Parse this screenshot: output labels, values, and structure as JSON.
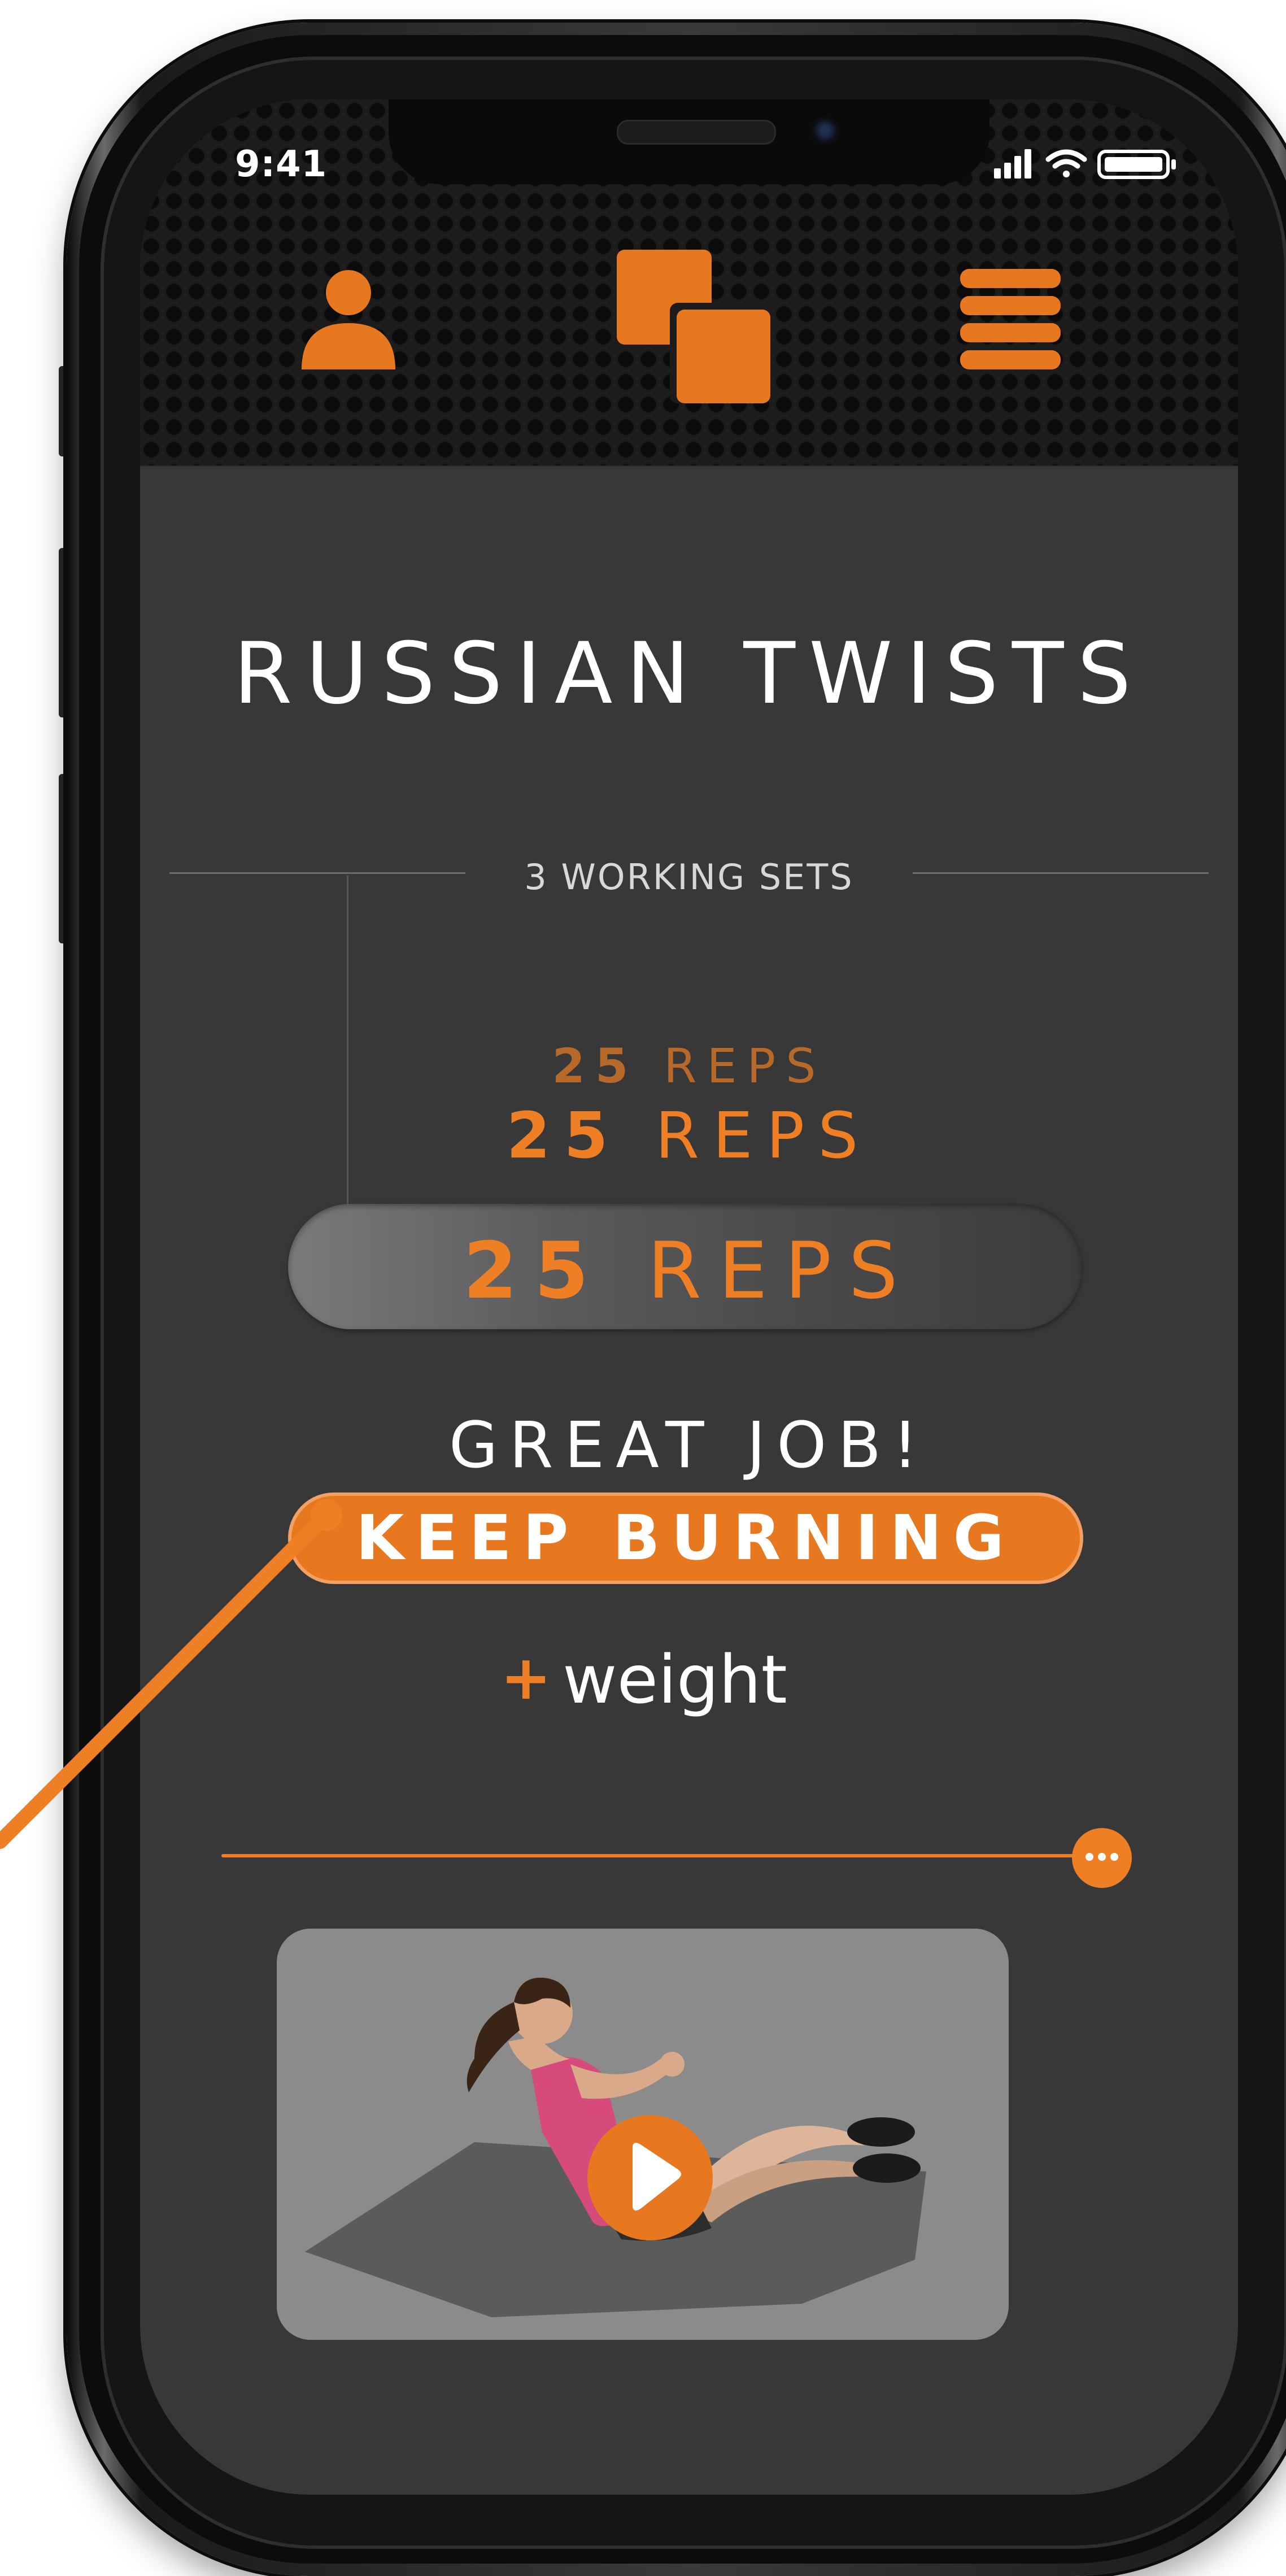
{
  "status_bar": {
    "time": "9:41"
  },
  "header": {
    "profile_icon": "user-icon",
    "logo_icon": "overlapping-squares-logo",
    "menu_icon": "hamburger-menu-icon"
  },
  "exercise": {
    "title": "RUSSIAN TWISTS",
    "sets_label": "3 WORKING SETS",
    "sets": [
      {
        "number": "25",
        "unit": "REPS"
      },
      {
        "number": "25",
        "unit": "REPS"
      },
      {
        "number": "25",
        "unit": "REPS"
      }
    ]
  },
  "feedback": {
    "message": "GREAT JOB!",
    "cta": "KEEP BURNING"
  },
  "weight": {
    "plus": "+",
    "label": "weight"
  },
  "progress": {
    "value": 1.0,
    "knob_icon": "more-dots-icon"
  },
  "video": {
    "play_icon": "play-icon"
  },
  "colors": {
    "accent": "#ee7f24",
    "background": "#383838",
    "header": "#1c1c1c",
    "text": "#ffffff"
  }
}
